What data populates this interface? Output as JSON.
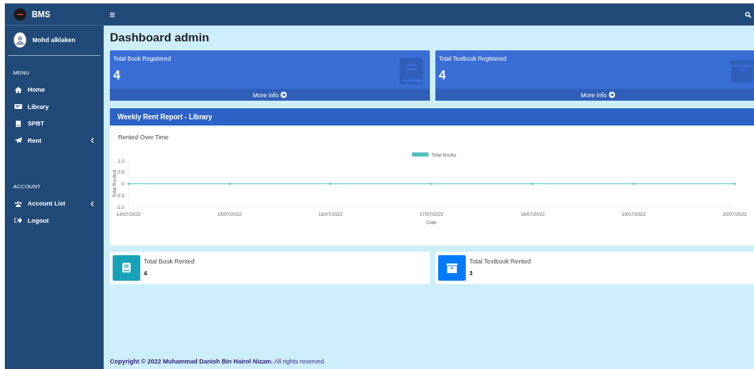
{
  "brand": {
    "name": "BMS"
  },
  "user": {
    "name": "Mohd alklaken"
  },
  "sidebar": {
    "sections": [
      {
        "heading": "MENU",
        "items": [
          {
            "label": "Home",
            "has_submenu": false
          },
          {
            "label": "Library",
            "has_submenu": false
          },
          {
            "label": "SPBT",
            "has_submenu": false
          },
          {
            "label": "Rent",
            "has_submenu": true
          }
        ]
      },
      {
        "heading": "ACCOUNT",
        "items": [
          {
            "label": "Account List",
            "has_submenu": true
          },
          {
            "label": "Logout",
            "has_submenu": false
          }
        ]
      }
    ]
  },
  "page_title": "Dashboard admin",
  "stat_boxes": [
    {
      "kind": "book",
      "label": "Total Book Registered",
      "value": "4",
      "link": "More info"
    },
    {
      "kind": "archive",
      "label": "Total Textbook Registered",
      "value": "4",
      "link": "More info"
    }
  ],
  "report": {
    "title": "Weekly Rent Report - Library",
    "chart_data": {
      "type": "line",
      "title": "Rented Over Time",
      "xlabel": "Date",
      "ylabel": "Total Rented",
      "categories": [
        "14/07/2022",
        "15/07/2022",
        "16/07/2022",
        "17/07/2022",
        "18/07/2022",
        "19/07/2022",
        "20/07/2022"
      ],
      "series": [
        {
          "name": "Total Books",
          "color": "#4bc0c0",
          "values": [
            0,
            0,
            0,
            0,
            0,
            0,
            0
          ]
        }
      ],
      "ylim": [
        -1,
        1
      ],
      "yticks": [
        {
          "value": 1,
          "label": "1.0"
        },
        {
          "value": 0.5,
          "label": "0.5"
        },
        {
          "value": 0,
          "label": "0"
        },
        {
          "value": -0.5,
          "label": "-0.5"
        },
        {
          "value": -1,
          "label": "-1.0"
        }
      ]
    }
  },
  "info_boxes": [
    {
      "kind": "book",
      "color": "#17a2b8",
      "label": "Total Book Rented",
      "value": "4"
    },
    {
      "kind": "archive",
      "color": "#007bff",
      "label": "Total Textbook Rented",
      "value": "3"
    }
  ],
  "footer": "**Copyright © 2022 Muhammad Danish Bin Hairol Nizam.** All rights reserved."
}
